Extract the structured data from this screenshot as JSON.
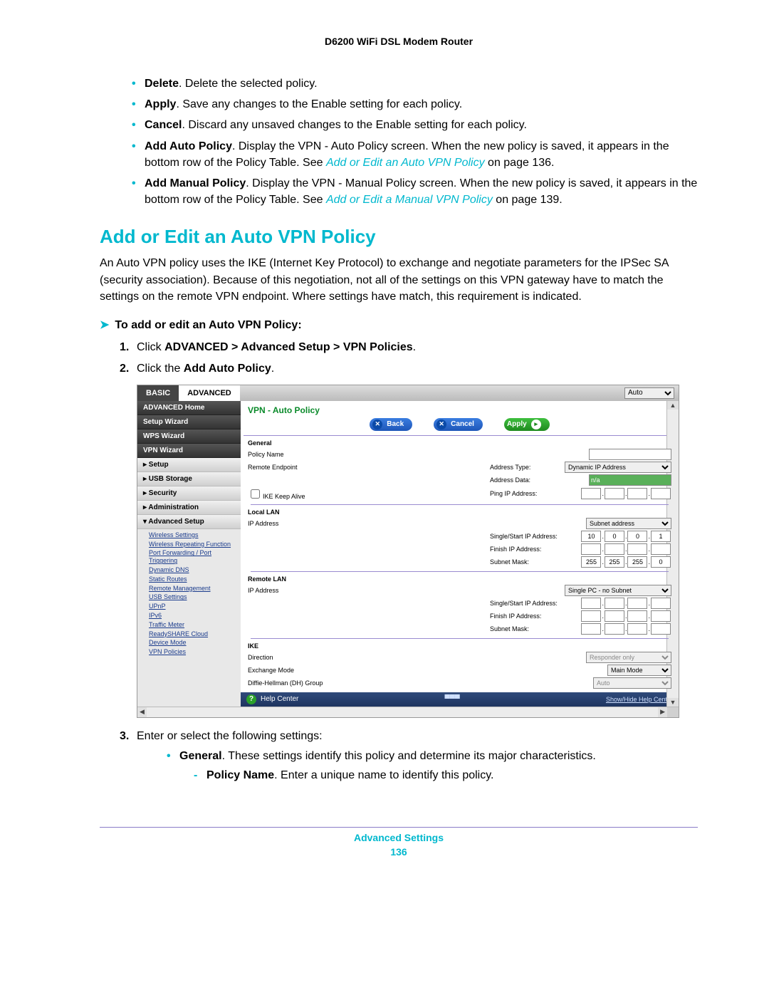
{
  "header": {
    "title": "D6200 WiFi DSL Modem Router"
  },
  "intro_bullets": [
    {
      "bold": "Delete",
      "text": ". Delete the selected policy."
    },
    {
      "bold": "Apply",
      "text": ". Save any changes to the Enable setting for each policy."
    },
    {
      "bold": "Cancel",
      "text": ". Discard any unsaved changes to the Enable setting for each policy."
    },
    {
      "bold": "Add Auto Policy",
      "text": ". Display the VPN - Auto Policy screen. When the new policy is saved, it appears in the bottom row of the Policy Table. See ",
      "link": "Add or Edit an Auto VPN Policy",
      "tail": " on page 136."
    },
    {
      "bold": "Add Manual Policy",
      "text": ". Display the VPN - Manual Policy screen. When the new policy is saved, it appears in the bottom row of the Policy Table. See ",
      "link": "Add or Edit a Manual VPN Policy",
      "tail": " on page 139."
    }
  ],
  "section": {
    "title": "Add or Edit an Auto VPN Policy",
    "para": "An Auto VPN policy uses the IKE (Internet Key Protocol) to exchange and negotiate parameters for the IPSec SA (security association). Because of this negotiation, not all of the settings on this VPN gateway have to match the settings on the remote VPN endpoint. Where settings have match, this requirement is indicated.",
    "procedure_title": "To add or edit an Auto VPN Policy:",
    "steps": {
      "s1_pre": "Click ",
      "s1_bold": "ADVANCED > Advanced Setup > VPN Policies",
      "s1_post": ".",
      "s2_pre": "Click the ",
      "s2_bold": "Add Auto Policy",
      "s2_post": ".",
      "s3": "Enter or select the following settings:",
      "s3_b1_bold": "General",
      "s3_b1_text": ". These settings identify this policy and determine its major characteristics.",
      "s3_d1_bold": "Policy Name",
      "s3_d1_text": ". Enter a unique name to identify this policy."
    }
  },
  "screenshot": {
    "tabs": {
      "basic": "BASIC",
      "advanced": "ADVANCED"
    },
    "top_select": "Auto",
    "side_primary": [
      "ADVANCED Home",
      "Setup Wizard",
      "WPS Wizard",
      "VPN Wizard"
    ],
    "side_sections": [
      "▸ Setup",
      "▸ USB Storage",
      "▸ Security",
      "▸ Administration",
      "▾ Advanced Setup"
    ],
    "side_links": [
      "Wireless Settings",
      "Wireless Repeating Function",
      "Port Forwarding / Port Triggering",
      "Dynamic DNS",
      "Static Routes",
      "Remote Management",
      "USB Settings",
      "UPnP",
      "IPv6",
      "Traffic Meter",
      "ReadySHARE Cloud",
      "Device Mode",
      "VPN Policies"
    ],
    "panel_title": "VPN - Auto Policy",
    "buttons": {
      "back": "Back",
      "cancel": "Cancel",
      "apply": "Apply"
    },
    "general": {
      "heading": "General",
      "policy_name_label": "Policy Name",
      "remote_endpoint_label": "Remote Endpoint",
      "address_type_label": "Address Type:",
      "address_type_value": "Dynamic IP Address",
      "address_data_label": "Address Data:",
      "address_data_value": "n/a",
      "ike_keepalive_label": "IKE Keep Alive",
      "ping_ip_label": "Ping IP Address:"
    },
    "local_lan": {
      "heading": "Local LAN",
      "ip_label": "IP Address",
      "mode": "Subnet address",
      "single_start_label": "Single/Start IP Address:",
      "single_start": [
        "10",
        "0",
        "0",
        "1"
      ],
      "finish_label": "Finish IP Address:",
      "subnet_label": "Subnet Mask:",
      "subnet": [
        "255",
        "255",
        "255",
        "0"
      ]
    },
    "remote_lan": {
      "heading": "Remote LAN",
      "ip_label": "IP Address",
      "mode": "Single PC - no Subnet",
      "single_start_label": "Single/Start IP Address:",
      "finish_label": "Finish IP Address:",
      "subnet_label": "Subnet Mask:"
    },
    "ike": {
      "heading": "IKE",
      "direction_label": "Direction",
      "direction_value": "Responder only",
      "exchange_label": "Exchange Mode",
      "exchange_value": "Main Mode",
      "dh_label": "Diffie-Hellman (DH) Group",
      "dh_value": "Auto"
    },
    "help": {
      "label": "Help Center",
      "toggle": "Show/Hide Help Center"
    }
  },
  "footer": {
    "section": "Advanced Settings",
    "page": "136"
  }
}
